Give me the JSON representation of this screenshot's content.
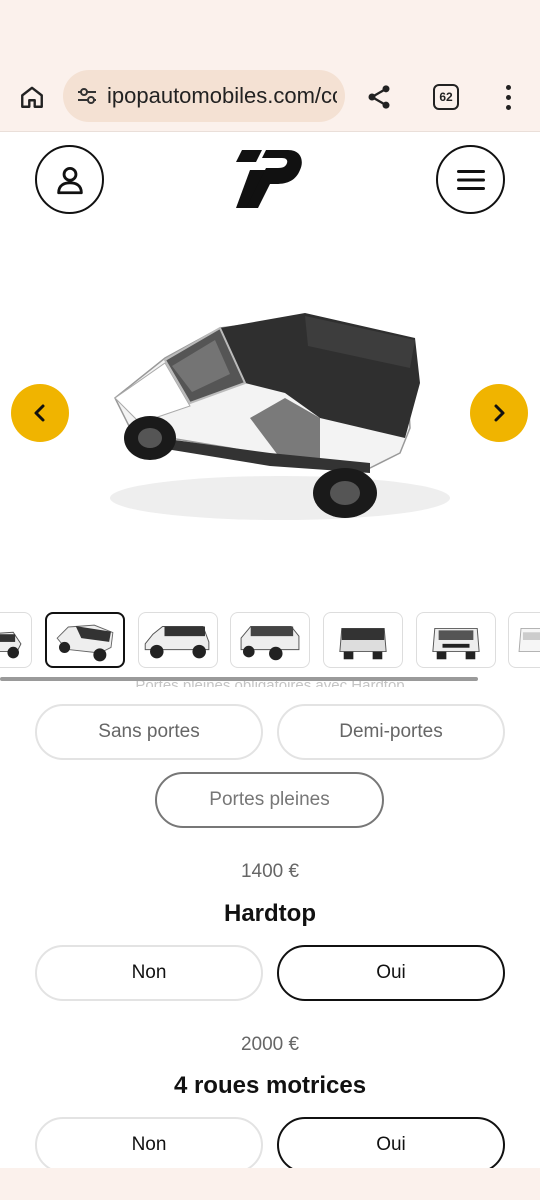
{
  "browser": {
    "url": "ipopautomobiles.com/cc",
    "tab_count": "62",
    "icons": {
      "home": "home-icon",
      "site_settings": "tune-icon",
      "share": "share-icon",
      "overflow": "more-vert-icon"
    }
  },
  "header": {
    "account_icon": "person-icon",
    "logo": "ipop-logo",
    "menu_icon": "hamburger-icon"
  },
  "carousel": {
    "accent_color": "#f0b400",
    "prev_icon": "chevron-left-icon",
    "next_icon": "chevron-right-icon",
    "thumbnail_count": 7,
    "active_thumbnail_index": 1
  },
  "doors": {
    "hint": "Portes pleines obligatoires avec Hardtop",
    "options": [
      "Sans portes",
      "Demi-portes",
      "Portes pleines"
    ],
    "selected": "Portes pleines"
  },
  "hardtop": {
    "price": "1400 €",
    "title": "Hardtop",
    "no_label": "Non",
    "yes_label": "Oui",
    "selected": "Oui"
  },
  "awd": {
    "price": "2000 €",
    "title": "4 roues motrices",
    "no_label": "Non",
    "yes_label": "Oui",
    "selected": "Oui"
  }
}
